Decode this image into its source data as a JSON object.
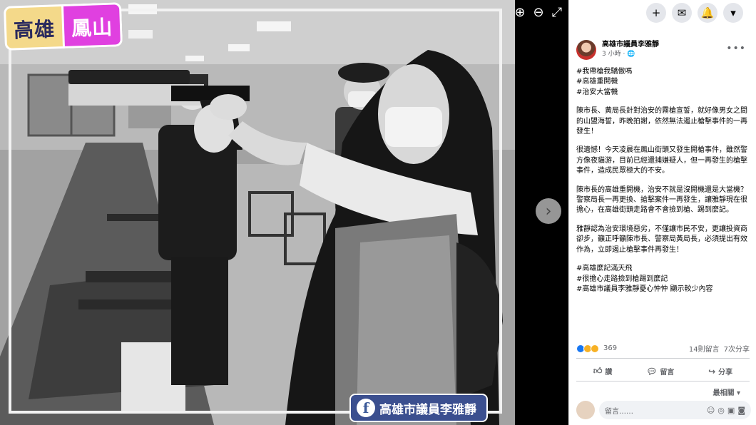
{
  "badge": {
    "part1": "高雄",
    "part2": "鳳山"
  },
  "watermark": {
    "logo": "f",
    "text": "高雄市議員李雅靜"
  },
  "viewer_controls": {
    "zoom_in": "⊕",
    "zoom_out": "⊖",
    "fullscreen": "⤢",
    "next": "›"
  },
  "top_actions": [
    "+",
    "✉",
    "🔔",
    "▾"
  ],
  "post": {
    "author": "高雄市議員李雅靜",
    "time": "3 小時",
    "privacy_icon": "globe-icon",
    "more": "•••",
    "hashtags_top": [
      "#我帶槍我驕傲嗎",
      "#高雄重開機",
      "#治安大當機"
    ],
    "paragraphs": [
      "陳市長、黃局長針對治安的霧槍宣誓，就好像男女之間的山盟海誓，昨晚拍謝，依然無法遏止槍擊事件的一再發生！",
      "很遺憾！今天凌晨在鳳山街頭又發生開槍事件，雖然警方像夜貓游，目前已經還捕嫌疑人，但一再發生的槍擊事件，造成民眾極大的不安。",
      "陳市長的高雄重開機，治安不就是沒開機還是大當機？警察局長一再更換、搶擊案件一再發生，讓雅靜現在很擔心，在高雄街頭走路會不會撿到槍、踢到麼記。",
      "雅靜認為治安環境惡劣，不僅讓市民不安，更讓投資商卻步，籲正呼籲陳市長、警察局黃局長，必須提出有效作為，立即遏止槍擊事件再發生！"
    ],
    "hashtags_bottom": [
      "#高雄麼記滿天飛",
      "#很擔心走路撿到槍踢到麼記",
      "#高雄市議員李雅靜憂心忡忡 顯示較少內容"
    ],
    "reaction_count": "369",
    "comment_count": "14則留言",
    "share_count": "7次分享",
    "actions": {
      "like": "讚",
      "comment": "留言",
      "share": "分享"
    },
    "sort_label": "最相關",
    "comment_placeholder": "留言……"
  },
  "colors": {
    "accent": "#1877f2",
    "badge_yellow": "#f4d98a",
    "badge_pink": "#e040e0",
    "watermark_bg": "#3b4f8f"
  }
}
